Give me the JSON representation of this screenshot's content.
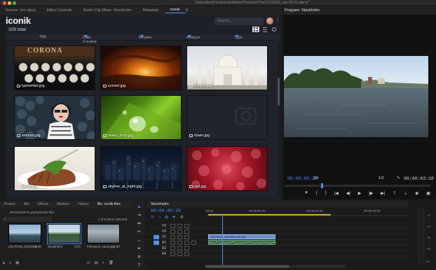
{
  "window": {
    "path": "/Users/kimi/Documents/Adobe/Premiere Pro/12.0/2018_Jan 09 01.prproj *"
  },
  "top_tabs": [
    {
      "label": "Source: (no clips)",
      "active": false
    },
    {
      "label": "Effect Controls",
      "active": false
    },
    {
      "label": "Audio Clip Mixer: Stockholm",
      "active": false
    },
    {
      "label": "Metadata",
      "active": false
    },
    {
      "label": "iconik",
      "active": true
    }
  ],
  "iconik": {
    "logo": "iconik",
    "total": "329 total",
    "search_placeholder": "Search...",
    "columns": [
      {
        "label": "Title",
        "sortable": false
      },
      {
        "label": "Date Created",
        "sortable": true
      },
      {
        "label": "Review",
        "sortable": true
      },
      {
        "label": "Analyze",
        "sortable": true
      },
      {
        "label": "Type",
        "sortable": true
      }
    ],
    "assets": [
      {
        "name": "typewriter.jpg"
      },
      {
        "name": "sunset.jpg"
      },
      {
        "name": "temple.jpg"
      },
      {
        "name": "woman.jpg"
      },
      {
        "name": "water_drop.jpg"
      },
      {
        "name": "tower.jpg"
      },
      {
        "name": "steak.jpg"
      },
      {
        "name": "skyline_at_night.jpg"
      },
      {
        "name": "red.jpg"
      }
    ],
    "typewriter_brand": "CORONA"
  },
  "program": {
    "tab_label": "Program: Stockholm",
    "timecode_current": "00:00:00:28",
    "fit": "Fit",
    "scale": "1/2",
    "timecode_duration": "00:00:03:18"
  },
  "bin": {
    "tabs": [
      "Project",
      "Info",
      "Effects",
      "Markers",
      "History",
      "Bin: iconik files"
    ],
    "active_tab": "Bin: iconik files",
    "path": "2018Jan09-01.prproj/iconik files",
    "selection_info": "1 of 5 items selected",
    "clips": [
      {
        "name": "20170730_1912094...",
        "duration": "9:20"
      },
      {
        "name": "Stockholm",
        "duration": "3:23"
      },
      {
        "name": "Filmstock_sand.jpg",
        "duration": "5:00"
      }
    ]
  },
  "timeline": {
    "tab_label": "Stockholm",
    "timecode": "00:00:00:28",
    "ruler": [
      "00:00",
      "00:00:05:00",
      "00:00:10:00",
      "00:00:15:00"
    ],
    "tracks": [
      "V3",
      "V2",
      "V1",
      "A1",
      "A2",
      "A3"
    ],
    "clip_video": "20170730_1912094.mov [V]",
    "clip_audio": ""
  },
  "meter": {
    "labels": [
      "-12",
      "-24",
      "-36",
      "-48",
      "dB"
    ]
  }
}
